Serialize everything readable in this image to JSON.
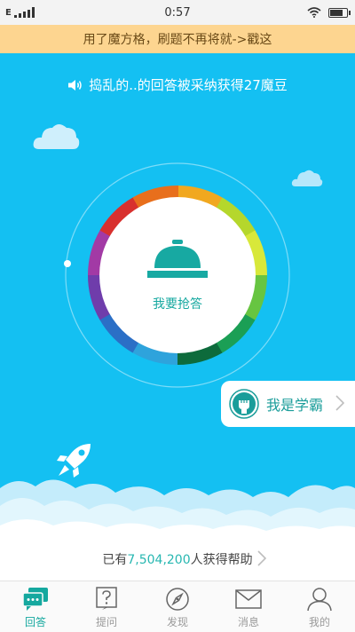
{
  "status_bar": {
    "network": "E",
    "time": "0:57"
  },
  "notice": {
    "text": "用了魔方格，刷题不再将就->戳这"
  },
  "broadcast": {
    "text": "捣乱的..的回答被采纳获得27魔豆"
  },
  "grab_button": {
    "label": "我要抢答"
  },
  "xueba_button": {
    "label": "我是学霸"
  },
  "helped": {
    "prefix": "已有",
    "count": "7,504,200",
    "suffix": "人获得帮助"
  },
  "tabs": [
    {
      "label": "回答",
      "icon": "chat-icon",
      "active": true
    },
    {
      "label": "提问",
      "icon": "question-icon",
      "active": false
    },
    {
      "label": "发现",
      "icon": "compass-icon",
      "active": false
    },
    {
      "label": "消息",
      "icon": "mail-icon",
      "active": false
    },
    {
      "label": "我的",
      "icon": "person-icon",
      "active": false
    }
  ],
  "colors": {
    "sky": "#14c0f2",
    "notice_bg": "#fdd590",
    "accent": "#15a89f",
    "tab_inactive": "#9a9a9a",
    "ring_segments": [
      "#f1a81f",
      "#b5d72c",
      "#d8e83a",
      "#67c541",
      "#1b9f55",
      "#0d6b3c",
      "#2ea3dc",
      "#2b6fc6",
      "#6f3dab",
      "#a23aa5",
      "#d8302e",
      "#e86f1c"
    ]
  }
}
